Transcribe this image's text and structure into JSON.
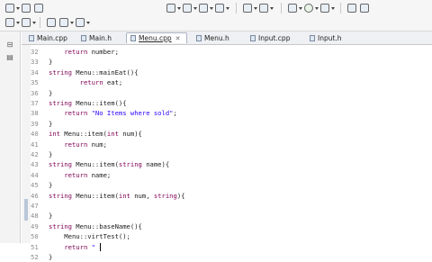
{
  "tabs": [
    {
      "label": "Main.cpp",
      "active": false
    },
    {
      "label": "Main.h",
      "active": false
    },
    {
      "label": "Menu.cpp",
      "active": true
    },
    {
      "label": "Menu.h",
      "active": false
    },
    {
      "label": "Input.cpp",
      "active": false
    },
    {
      "label": "Input.h",
      "active": false
    }
  ],
  "editor": {
    "lines": [
      {
        "num": "32",
        "code": "    return number;"
      },
      {
        "num": "33",
        "code": "}"
      },
      {
        "num": "34",
        "code": "string Menu::mainEat(){"
      },
      {
        "num": "35",
        "code": "        return eat;"
      },
      {
        "num": "36",
        "code": "}"
      },
      {
        "num": "37",
        "code": "string Menu::item(){"
      },
      {
        "num": "38",
        "code": "    return \"No Items where sold\";"
      },
      {
        "num": "39",
        "code": "}"
      },
      {
        "num": "40",
        "code": "int Menu::item(int num){"
      },
      {
        "num": "41",
        "code": "    return num;"
      },
      {
        "num": "42",
        "code": "}"
      },
      {
        "num": "43",
        "code": "string Menu::item(string name){"
      },
      {
        "num": "44",
        "code": "    return name;"
      },
      {
        "num": "45",
        "code": "}"
      },
      {
        "num": "46",
        "code": "string Menu::item(int num, string){"
      },
      {
        "num": "47",
        "code": ""
      },
      {
        "num": "48",
        "code": "}"
      },
      {
        "num": "49",
        "code": "string Menu::baseName(){"
      },
      {
        "num": "50",
        "code": "    Menu::virtTest();"
      },
      {
        "num": "51",
        "code": "    return \" "
      },
      {
        "num": "52",
        "code": "}"
      }
    ]
  },
  "colors": {
    "keyword": "#7f0055",
    "string": "#2a00ff",
    "line_number": "#8a8a8a"
  }
}
